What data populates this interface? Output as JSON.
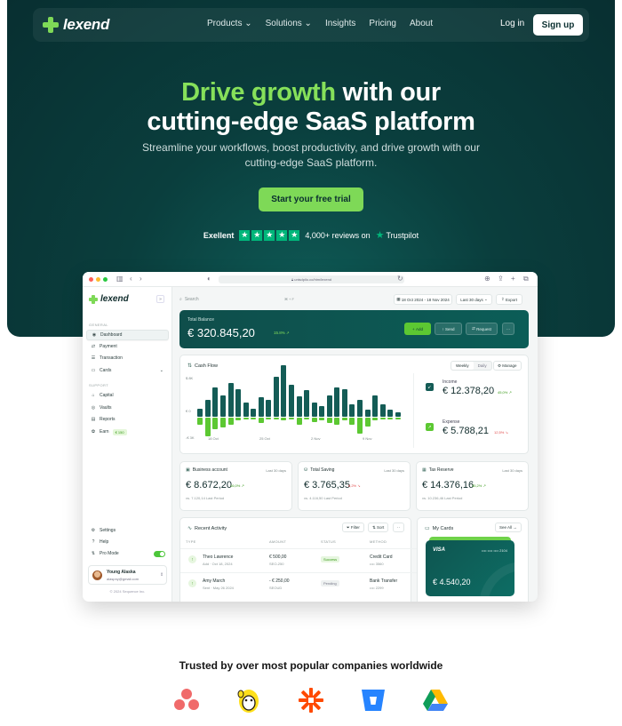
{
  "brand": {
    "name": "lexend",
    "accent": "#7ed957",
    "dark": "#0a3e3d"
  },
  "nav": {
    "links": [
      "Products",
      "Solutions",
      "Insights",
      "Pricing",
      "About"
    ],
    "login": "Log in",
    "signup": "Sign up"
  },
  "hero": {
    "headline_accent": "Drive growth",
    "headline_rest_1": " with our",
    "headline_line_2": "cutting-edge SaaS platform",
    "subtitle": "Streamline your workflows, boost productivity, and drive growth with our cutting-edge SaaS platform.",
    "cta": "Start your free trial",
    "rating_word": "Exellent",
    "reviews": "4,000+ reviews on",
    "trustpilot": "Trustpilot"
  },
  "app": {
    "url": "unisdpilo.co/htm/lexend",
    "sidebar": {
      "general_label": "GENERAL",
      "general": [
        {
          "label": "Dashboard",
          "icon": "dashboard-icon",
          "glyph": "◉"
        },
        {
          "label": "Payment",
          "icon": "payment-icon",
          "glyph": "⇄"
        },
        {
          "label": "Transaction",
          "icon": "transaction-icon",
          "glyph": "☰"
        },
        {
          "label": "Cards",
          "icon": "card-icon",
          "glyph": "▭"
        }
      ],
      "support_label": "SUPPORT",
      "support": [
        {
          "label": "Capital",
          "icon": "capital-icon",
          "glyph": "⌂"
        },
        {
          "label": "Vaults",
          "icon": "vault-icon",
          "glyph": "◎"
        },
        {
          "label": "Reports",
          "icon": "report-icon",
          "glyph": "▤"
        },
        {
          "label": "Earn",
          "icon": "earn-icon",
          "glyph": "✿",
          "badge": "€ 150"
        }
      ],
      "bottom": [
        {
          "label": "Settings",
          "icon": "gear-icon",
          "glyph": "⚙"
        },
        {
          "label": "Help",
          "icon": "help-icon",
          "glyph": "?"
        },
        {
          "label": "Pro Mode",
          "icon": "pro-mode-icon",
          "glyph": "⇅"
        }
      ],
      "user_name": "Young Alaska",
      "user_email": "alaspny@gmail.com",
      "copyright": "© 2024 Sequence Inc."
    },
    "topbar": {
      "search_placeholder": "Search",
      "shortcut": "⌘ + F",
      "date_range": "18 Oct 2024 - 18 Nov 2024",
      "period": "Last 30 days",
      "export": "Export"
    },
    "balance": {
      "label": "Total Balance",
      "amount": "€ 320.845,20",
      "change": "15.8%",
      "add": "Add",
      "send": "Send",
      "request": "Request"
    },
    "cashflow": {
      "title": "Cash Flow",
      "weekly": "Weekly",
      "daily": "Daily",
      "manage": "Manage",
      "income_label": "Income",
      "income_amount": "€ 12.378,20",
      "income_change": "45,0%",
      "expense_label": "Expense",
      "expense_amount": "€ 5.788,21",
      "expense_change": "12,5%"
    },
    "stats": [
      {
        "title": "Business account",
        "period": "Last 30 days",
        "amount": "€ 8.672,20",
        "change": "16,0%",
        "dir": "up",
        "vs": "vs. 7.120,14 Last Period",
        "icon": "business-icon",
        "glyph": "▣"
      },
      {
        "title": "Total Saving",
        "period": "Last 30 days",
        "amount": "€ 3.765,35",
        "change": "8,2%",
        "dir": "down",
        "vs": "vs. 4.116,50 Last Period",
        "icon": "saving-icon",
        "glyph": "⛁"
      },
      {
        "title": "Tax Reserve",
        "period": "Last 30 days",
        "amount": "€ 14.376,16",
        "change": "35,2%",
        "dir": "up",
        "vs": "vs. 10.236,46 Last Period",
        "icon": "tax-icon",
        "glyph": "▦"
      }
    ],
    "activity": {
      "title": "Recent Activity",
      "filter": "Filter",
      "sort": "Sort",
      "columns": [
        "TYPE",
        "AMOUNT",
        "STATUS",
        "METHOD"
      ],
      "rows": [
        {
          "name": "Theo Lawrence",
          "date": "Add · Oct 18, 2024",
          "amount": "€ 500,00",
          "currency": "SEO-250",
          "status": "Success",
          "method": "Credit Card",
          "method_detail": "•••• 3560"
        },
        {
          "name": "Amy March",
          "date": "Sent · May 26 2024",
          "amount": "- € 250,00",
          "currency": "SEOUD",
          "status": "Pending",
          "method": "Bank Transfer",
          "method_detail": "•••• 2299"
        }
      ]
    },
    "cards": {
      "title": "My Cards",
      "see_all": "See All",
      "card_brand": "VISA",
      "card_number": "•••• •••• •••• 2104",
      "card_balance": "€ 4.540,20"
    }
  },
  "companies": {
    "heading": "Trusted by over most popular companies worldwide",
    "logos": [
      "asana-icon",
      "mailchimp-icon",
      "zapier-icon",
      "bitbucket-icon",
      "google-drive-icon"
    ]
  },
  "chart_data": {
    "type": "bar",
    "title": "Cash Flow",
    "yticks": [
      "$ 8K",
      "€ 0",
      "-€ 3K"
    ],
    "xticks": [
      "18 Oct",
      "25 Oct",
      "2 Nov",
      "9 Nov"
    ],
    "ylim": [
      -3,
      8
    ],
    "series": [
      {
        "name": "Income",
        "color": "#145c56",
        "values": [
          1.2,
          2.6,
          4.6,
          3.3,
          5.3,
          4.3,
          2.2,
          1.3,
          3.1,
          2.7,
          6.3,
          8.2,
          5.1,
          3.2,
          4.2,
          2.2,
          1.6,
          3.3,
          4.6,
          4.3,
          1.9,
          2.6,
          1.1,
          3.3,
          2.0,
          1.1,
          0.6
        ]
      },
      {
        "name": "Expense",
        "color": "#5cc832",
        "values": [
          -1.2,
          -3.0,
          -1.9,
          -1.6,
          -1.2,
          -0.5,
          -0.3,
          -0.3,
          -0.9,
          -0.3,
          -0.3,
          -0.5,
          -0.3,
          -1.1,
          -0.3,
          -0.8,
          -0.4,
          -0.9,
          -1.2,
          -0.4,
          -1.2,
          -2.6,
          -1.5,
          -0.5,
          -0.3,
          -0.3,
          -0.3
        ]
      }
    ]
  }
}
